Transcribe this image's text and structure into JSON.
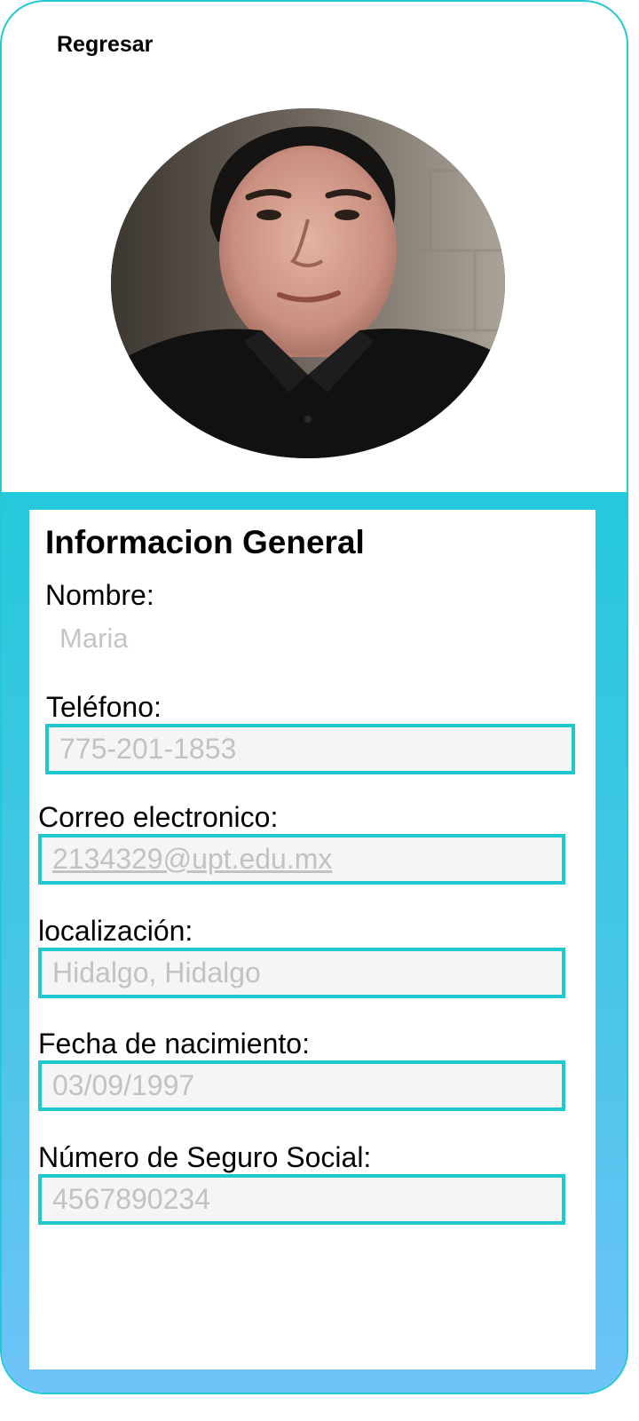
{
  "header": {
    "back_label": "Regresar"
  },
  "profile": {
    "section_title": "Informacion General",
    "fields": {
      "name": {
        "label": "Nombre:",
        "value": "Maria"
      },
      "phone": {
        "label": "Teléfono:",
        "value": "775-201-1853"
      },
      "email": {
        "label": "Correo electronico:",
        "value": "2134329@upt.edu.mx"
      },
      "location": {
        "label": "localización:",
        "value": "Hidalgo, Hidalgo"
      },
      "birthdate": {
        "label": "Fecha de nacimiento:",
        "value": "03/09/1997"
      },
      "ssn": {
        "label": "Número de Seguro Social:",
        "value": "4567890234"
      }
    }
  },
  "colors": {
    "accent": "#22c8d2",
    "field_border": "#1ec8cc",
    "panel_gradient_top": "#25c9dc",
    "panel_gradient_bottom": "#6ec3f8",
    "placeholder_text": "#c2c2c2"
  }
}
